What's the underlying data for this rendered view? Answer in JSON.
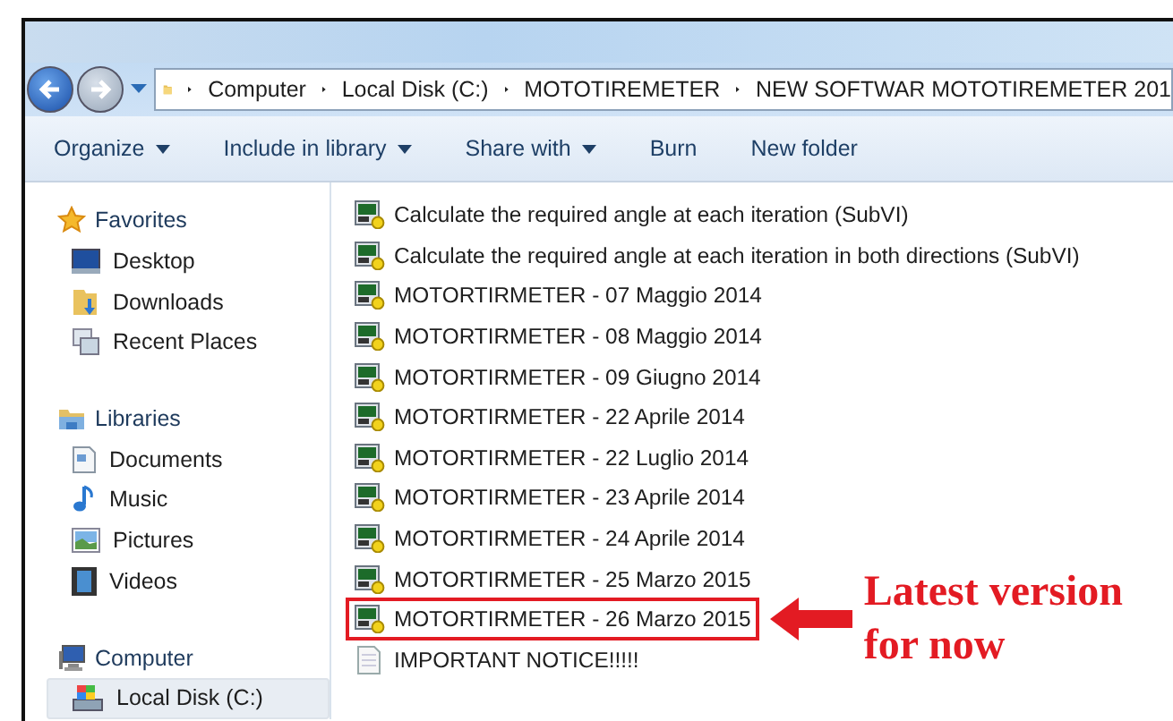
{
  "address_bar": {
    "crumbs": [
      "Computer",
      "Local Disk (C:)",
      "MOTOTIREMETER",
      "NEW SOFTWAR MOTOTIREMETER 201"
    ]
  },
  "toolbar": [
    {
      "label": "Organize",
      "has_menu": true
    },
    {
      "label": "Include in library",
      "has_menu": true
    },
    {
      "label": "Share with",
      "has_menu": true
    },
    {
      "label": "Burn",
      "has_menu": false
    },
    {
      "label": "New folder",
      "has_menu": false
    }
  ],
  "sidebar": {
    "groups": [
      {
        "label": "Favorites",
        "kind": "star",
        "items": [
          {
            "label": "Desktop",
            "kind": "desktop",
            "selected": false
          },
          {
            "label": "Downloads",
            "kind": "downloads",
            "selected": false
          },
          {
            "label": "Recent Places",
            "kind": "recent",
            "selected": false
          }
        ]
      },
      {
        "label": "Libraries",
        "kind": "library",
        "items": [
          {
            "label": "Documents",
            "kind": "documents",
            "selected": false
          },
          {
            "label": "Music",
            "kind": "music",
            "selected": false
          },
          {
            "label": "Pictures",
            "kind": "pictures",
            "selected": false
          },
          {
            "label": "Videos",
            "kind": "videos",
            "selected": false
          }
        ]
      },
      {
        "label": "Computer",
        "kind": "computer",
        "items": [
          {
            "label": "Local Disk (C:)",
            "kind": "disk",
            "selected": true
          }
        ]
      }
    ]
  },
  "files": [
    {
      "name": "Calculate the required angle at each iteration (SubVI)",
      "kind": "vi",
      "highlighted": false
    },
    {
      "name": "Calculate the required angle at each iteration in both directions (SubVI)",
      "kind": "vi",
      "highlighted": false
    },
    {
      "name": "MOTORTIRMETER - 07 Maggio 2014",
      "kind": "vi",
      "highlighted": false
    },
    {
      "name": "MOTORTIRMETER - 08 Maggio 2014",
      "kind": "vi",
      "highlighted": false
    },
    {
      "name": "MOTORTIRMETER - 09 Giugno 2014",
      "kind": "vi",
      "highlighted": false
    },
    {
      "name": "MOTORTIRMETER - 22 Aprile 2014",
      "kind": "vi",
      "highlighted": false
    },
    {
      "name": "MOTORTIRMETER - 22 Luglio 2014",
      "kind": "vi",
      "highlighted": false
    },
    {
      "name": "MOTORTIRMETER - 23 Aprile 2014",
      "kind": "vi",
      "highlighted": false
    },
    {
      "name": "MOTORTIRMETER - 24 Aprile 2014",
      "kind": "vi",
      "highlighted": false
    },
    {
      "name": "MOTORTIRMETER - 25 Marzo 2015",
      "kind": "vi",
      "highlighted": false
    },
    {
      "name": "MOTORTIRMETER - 26 Marzo 2015",
      "kind": "vi",
      "highlighted": true
    },
    {
      "name": "IMPORTANT NOTICE!!!!!",
      "kind": "text",
      "highlighted": false
    }
  ],
  "annotation": {
    "text": "Latest version for now"
  }
}
